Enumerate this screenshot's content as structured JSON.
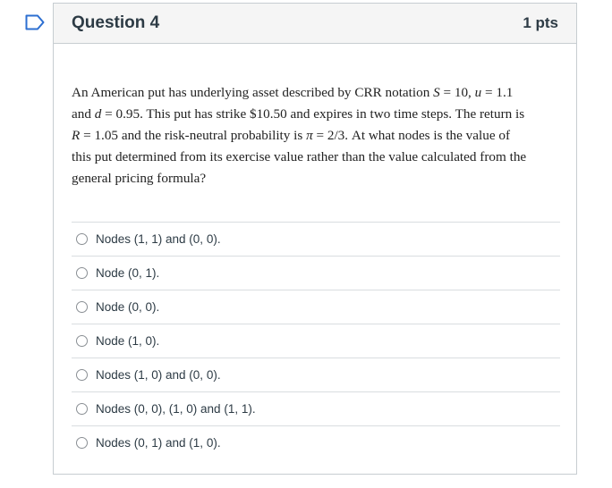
{
  "question": {
    "title": "Question 4",
    "points": "1 pts",
    "text": {
      "p1": "An American put has underlying asset described by CRR notation ",
      "s_var": "S",
      "eq1": " = 10, ",
      "u_var": "u",
      "eq2": " = 1.1",
      "p2": "and ",
      "d_var": "d",
      "eq3": " = 0.95",
      "p3": ". This put has strike $10.50 and expires in two time steps. The return is",
      "r_var": "R",
      "eq4": " = 1.05",
      "p4": " and the risk-neutral probability is ",
      "pi_var": "π",
      "eq5": " = 2/3",
      "p5": ". At what nodes is the value of",
      "p6": "this put determined from its exercise value rather than the value calculated from the",
      "p7": "general pricing formula?"
    }
  },
  "answers": [
    {
      "label": "Nodes (1, 1) and (0, 0)."
    },
    {
      "label": "Node (0, 1)."
    },
    {
      "label": "Node (0, 0)."
    },
    {
      "label": "Node (1, 0)."
    },
    {
      "label": "Nodes (1, 0) and (0, 0)."
    },
    {
      "label": "Nodes (0, 0), (1, 0) and (1, 1)."
    },
    {
      "label": "Nodes (0, 1) and (1, 0)."
    }
  ],
  "icons": {
    "flag": "flag-icon"
  },
  "colors": {
    "flag": "#2d6fd1",
    "header_bg": "#f5f5f5",
    "border": "#c7cdd1"
  }
}
